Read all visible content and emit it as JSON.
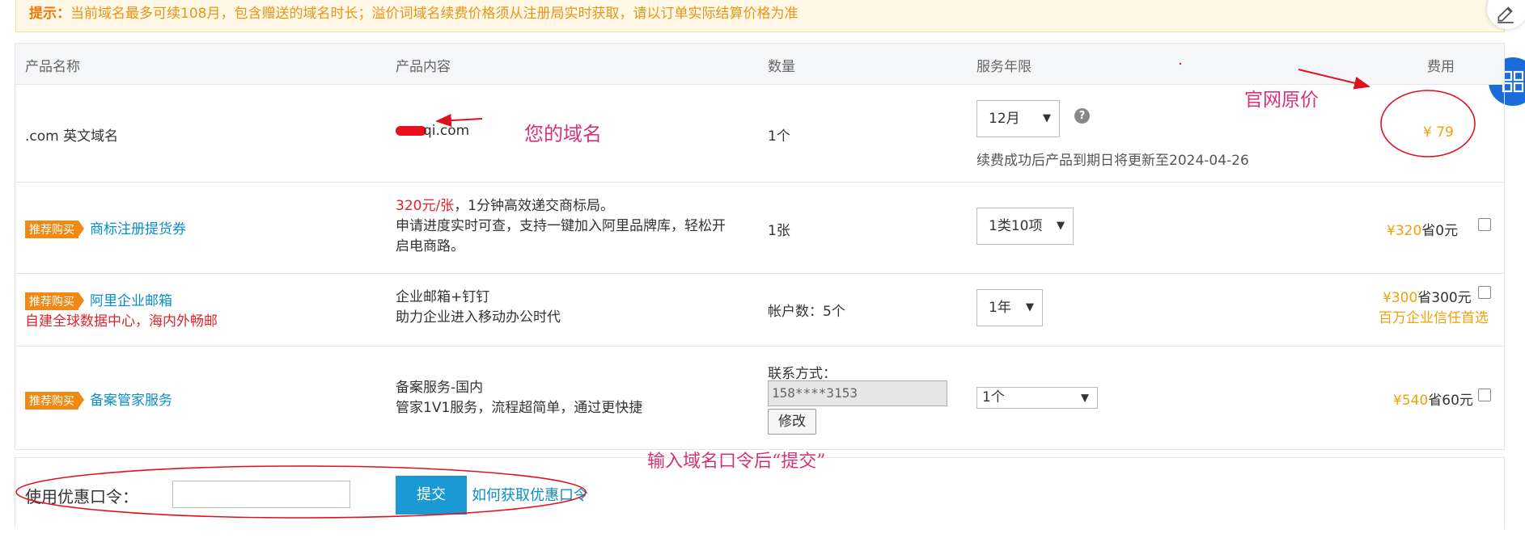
{
  "notice": {
    "label": "提示：",
    "text": "当前域名最多可续108月，包含赠送的域名时长；溢价词域名续费价格须从注册局实时获取，请以订单实际结算价格为准"
  },
  "headers": {
    "name": "产品名称",
    "content": "产品内容",
    "qty": "数量",
    "term": "服务年限",
    "fee": "费用"
  },
  "rows": [
    {
      "name": ".com 英文域名",
      "content": "qi.com",
      "qty": "1个",
      "term": "12月",
      "renew_note": "续费成功后产品到期日将更新至2024-04-26",
      "price": "¥ 79"
    },
    {
      "badge": "推荐购买",
      "name": "商标注册提货券",
      "content_highlight": "320元/张",
      "content_rest": "，1分钟高效递交商标局。",
      "content_line2": "申请进度实时可查，支持一键加入阿里品牌库，轻松开",
      "content_line3": "启电商路。",
      "qty": "1张",
      "term": "1类10项",
      "price": "¥320",
      "save": "省0元"
    },
    {
      "badge": "推荐购买",
      "name": "阿里企业邮箱",
      "slogan": "自建全球数据中心，海内外畅邮",
      "content_line1": "企业邮箱+钉钉",
      "content_line2": "助力企业进入移动办公时代",
      "qty": "帐户数：5个",
      "term": "1年",
      "price": "¥300",
      "save": "省300元",
      "promo": "百万企业信任首选"
    },
    {
      "badge": "推荐购买",
      "name": "备案管家服务",
      "content_line1": "备案服务-国内",
      "content_line2": "管家1V1服务，流程超简单，通过更快捷",
      "contact_label": "联系方式：",
      "contact_value": "158****3153",
      "modify": "修改",
      "term": "1个",
      "price": "¥540",
      "save": "省60元"
    }
  ],
  "coupon": {
    "label": "使用优惠口令：",
    "input_value": "",
    "submit": "提交",
    "help_link": "如何获取优惠口令"
  },
  "annotations": {
    "your_domain": "您的域名",
    "official_price": "官网原价",
    "submit_hint": "输入域名口令后“提交”"
  },
  "colors": {
    "accent": "#0a8ec7",
    "price": "#f0a008",
    "badge": "#f08a14",
    "annotation": "#d6327a"
  }
}
